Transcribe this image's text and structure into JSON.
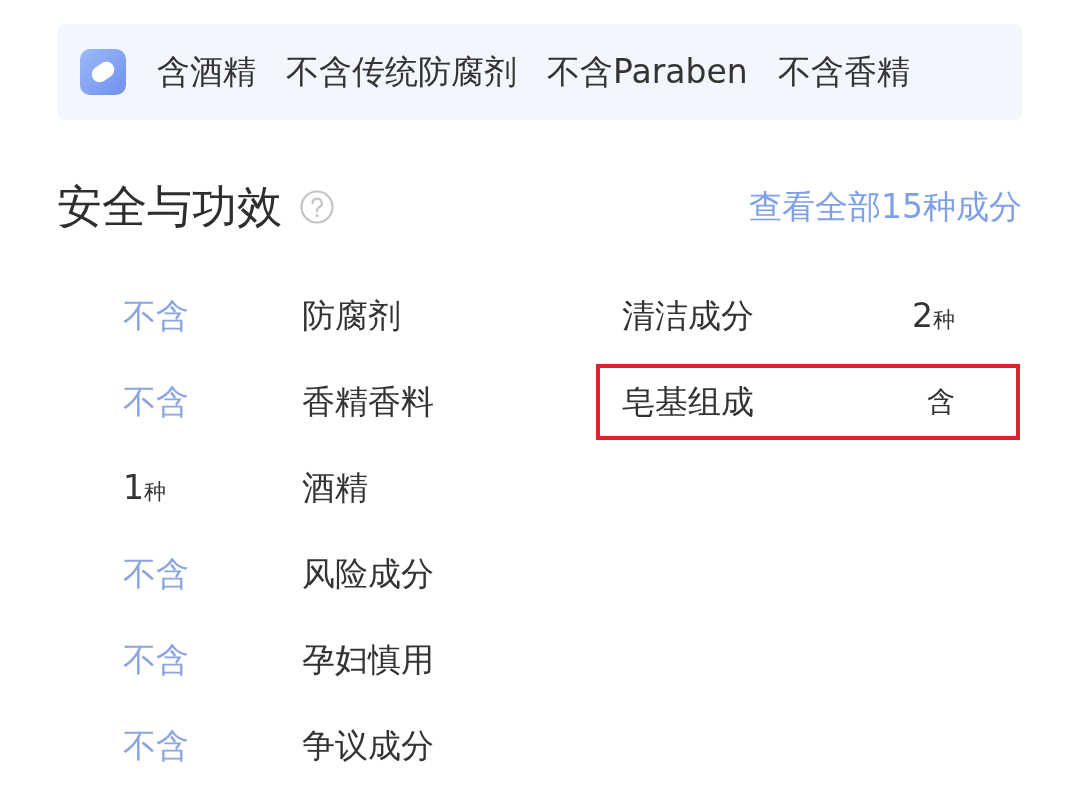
{
  "banner": {
    "tags": [
      "含酒精",
      "不含传统防腐剂",
      "不含Paraben",
      "不含香精"
    ]
  },
  "section": {
    "title": "安全与功效",
    "link": "查看全部15种成分"
  },
  "left_column": [
    {
      "kind": "absent",
      "value": "不含",
      "name": "防腐剂"
    },
    {
      "kind": "absent",
      "value": "不含",
      "name": "香精香料"
    },
    {
      "kind": "count",
      "value": "1",
      "unit": "种",
      "name": "酒精"
    },
    {
      "kind": "absent",
      "value": "不含",
      "name": "风险成分"
    },
    {
      "kind": "absent",
      "value": "不含",
      "name": "孕妇慎用"
    },
    {
      "kind": "absent",
      "value": "不含",
      "name": "争议成分"
    }
  ],
  "right_column": [
    {
      "name": "清洁成分",
      "kind": "count",
      "value": "2",
      "unit": "种",
      "highlighted": false
    },
    {
      "name": "皂基组成",
      "kind": "present",
      "value": "含",
      "highlighted": true
    }
  ]
}
